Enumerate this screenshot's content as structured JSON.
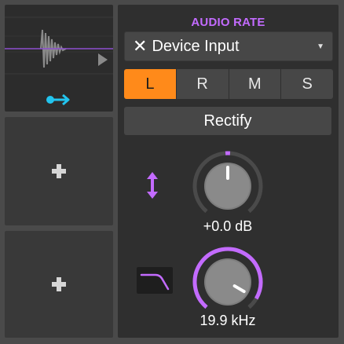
{
  "colors": {
    "accent_purple": "#c36bff",
    "active_orange": "#ff8a1a",
    "chain_blue": "#22c4ee"
  },
  "left_column": {
    "top_slot_icon": "waveform-preview",
    "chain_icon": "chain-arrow-icon",
    "add_icon": "plus-icon"
  },
  "panel": {
    "title": "AUDIO RATE",
    "source": {
      "icon": "close-x",
      "label": "Device Input",
      "caret": "▼"
    },
    "channels": [
      {
        "label": "L",
        "active": true
      },
      {
        "label": "R",
        "active": false
      },
      {
        "label": "M",
        "active": false
      },
      {
        "label": "S",
        "active": false
      }
    ],
    "rectify_label": "Rectify",
    "gain": {
      "value_label": "+0.0 dB",
      "icon": "bidirectional-arrow-icon",
      "level": 0.5
    },
    "filter": {
      "value_label": "19.9 kHz",
      "icon": "lowpass-filter-icon",
      "level": 0.93
    }
  }
}
